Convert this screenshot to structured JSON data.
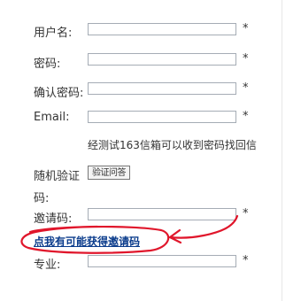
{
  "form": {
    "username_label": "用户名:",
    "password_label": "密码:",
    "confirm_password_label": "确认密码:",
    "email_label": "Email:",
    "email_hint": "经测试163信箱可以收到密码找回信",
    "captcha_label_line1": "随机验证",
    "captcha_label_line2": "码:",
    "captcha_image_text": "验证问答",
    "invite_label": "邀请码:",
    "invite_link": "点我有可能获得邀请码",
    "major_label": "专业:",
    "required_mark": "*"
  },
  "colors": {
    "annotation_red": "#e0162b",
    "link": "#0b3c8c"
  }
}
